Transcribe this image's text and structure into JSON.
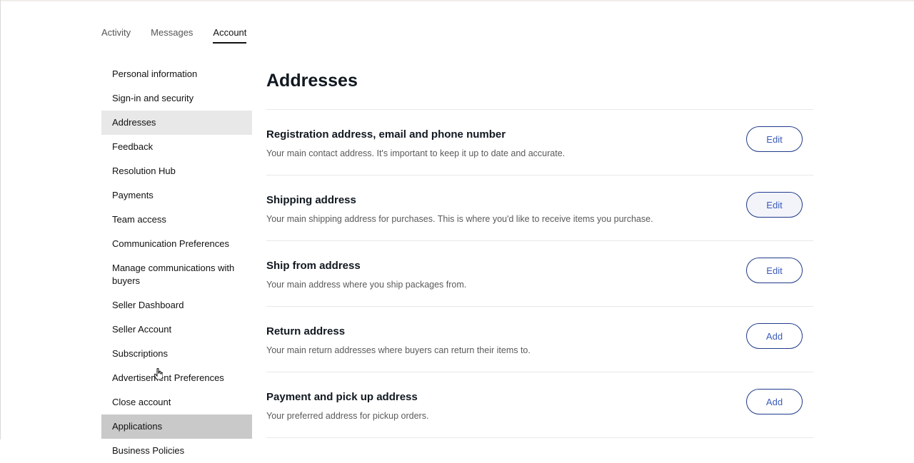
{
  "tabs": [
    {
      "label": "Activity"
    },
    {
      "label": "Messages"
    },
    {
      "label": "Account"
    }
  ],
  "sidebar": {
    "items": [
      {
        "label": "Personal information"
      },
      {
        "label": "Sign-in and security"
      },
      {
        "label": "Addresses"
      },
      {
        "label": "Feedback"
      },
      {
        "label": "Resolution Hub"
      },
      {
        "label": "Payments"
      },
      {
        "label": "Team access"
      },
      {
        "label": "Communication Preferences"
      },
      {
        "label": "Manage communications with buyers"
      },
      {
        "label": "Seller Dashboard"
      },
      {
        "label": "Seller Account"
      },
      {
        "label": "Subscriptions"
      },
      {
        "label": "Advertisement Preferences"
      },
      {
        "label": "Close account"
      },
      {
        "label": "Applications"
      },
      {
        "label": "Business Policies"
      }
    ]
  },
  "main": {
    "title": "Addresses",
    "sections": [
      {
        "title": "Registration address, email and phone number",
        "description": "Your main contact address. It's important to keep it up to date and accurate.",
        "button": "Edit"
      },
      {
        "title": "Shipping address",
        "description": "Your main shipping address for purchases. This is where you'd like to receive items you purchase.",
        "button": "Edit"
      },
      {
        "title": "Ship from address",
        "description": "Your main address where you ship packages from.",
        "button": "Edit"
      },
      {
        "title": "Return address",
        "description": "Your main return addresses where buyers can return their items to.",
        "button": "Add"
      },
      {
        "title": "Payment and pick up address",
        "description": "Your preferred address for pickup orders.",
        "button": "Add"
      }
    ]
  }
}
